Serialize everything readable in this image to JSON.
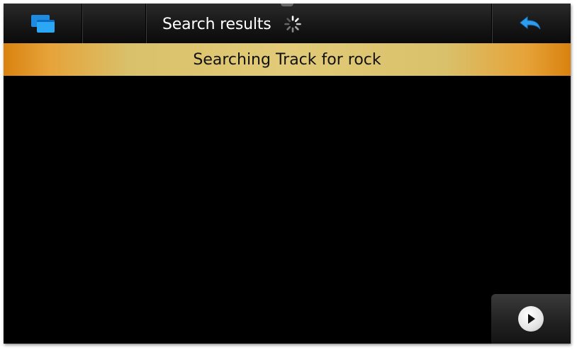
{
  "title_bar": {
    "title": "Search results",
    "task_switcher_icon": "task-switcher-icon",
    "loading_icon": "loading-spinner-icon",
    "back_icon": "back-arrow-icon"
  },
  "banner": {
    "text": "Searching Track for rock"
  },
  "controls": {
    "play_icon": "play-icon"
  },
  "colors": {
    "accent_blue": "#1e8be0",
    "banner_orange": "#d9820f",
    "banner_gold": "#e2cb78",
    "background": "#000000"
  }
}
